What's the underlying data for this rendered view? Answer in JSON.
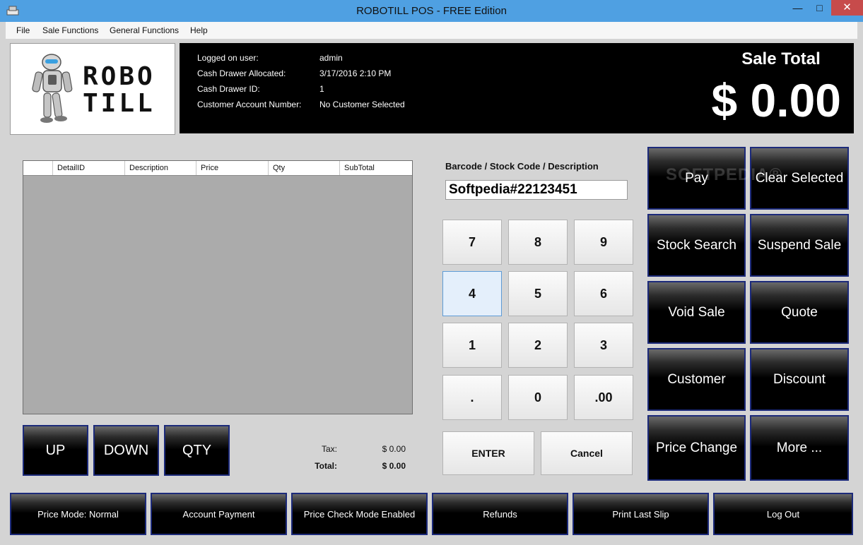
{
  "window": {
    "title": "ROBOTILL POS - FREE Edition",
    "minimize": "—",
    "maximize": "□",
    "close": "✕"
  },
  "menu": [
    "File",
    "Sale Functions",
    "General Functions",
    "Help"
  ],
  "logo": {
    "line1": "ROBO",
    "line2": "TILL"
  },
  "info": {
    "rows": [
      {
        "label": "Logged on user:",
        "value": "admin"
      },
      {
        "label": "Cash Drawer Allocated:",
        "value": "3/17/2016 2:10 PM"
      },
      {
        "label": "Cash Drawer ID:",
        "value": "1"
      },
      {
        "label": "Customer Account Number:",
        "value": "No Customer Selected"
      }
    ],
    "sale_total_label": "Sale Total",
    "sale_total_value": "$ 0.00"
  },
  "grid": {
    "columns": [
      "DetailID",
      "Description",
      "Price",
      "Qty",
      "SubTotal"
    ]
  },
  "nav_buttons": [
    "UP",
    "DOWN",
    "QTY"
  ],
  "totals": {
    "tax_label": "Tax:",
    "tax_value": "$ 0.00",
    "total_label": "Total:",
    "total_value": "$ 0.00"
  },
  "barcode": {
    "label": "Barcode / Stock Code / Description",
    "value": "Softpedia#22123451"
  },
  "keypad": {
    "keys": [
      "7",
      "8",
      "9",
      "4",
      "5",
      "6",
      "1",
      "2",
      "3",
      ".",
      "0",
      ".00"
    ],
    "selected": "4",
    "enter": "ENTER",
    "cancel": "Cancel"
  },
  "side_buttons": [
    "Pay",
    "Clear Selected",
    "Stock Search",
    "Suspend Sale",
    "Void Sale",
    "Quote",
    "Customer",
    "Discount",
    "Price Change",
    "More ..."
  ],
  "bottom_buttons": [
    "Price Mode: Normal",
    "Account Payment",
    "Price Check Mode Enabled",
    "Refunds",
    "Print Last Slip",
    "Log Out"
  ],
  "watermark": "SOFTPEDIA®",
  "colors": {
    "title_bar": "#4fa0e2",
    "button_border": "#1c2a7a",
    "close_button": "#c74b4b"
  }
}
